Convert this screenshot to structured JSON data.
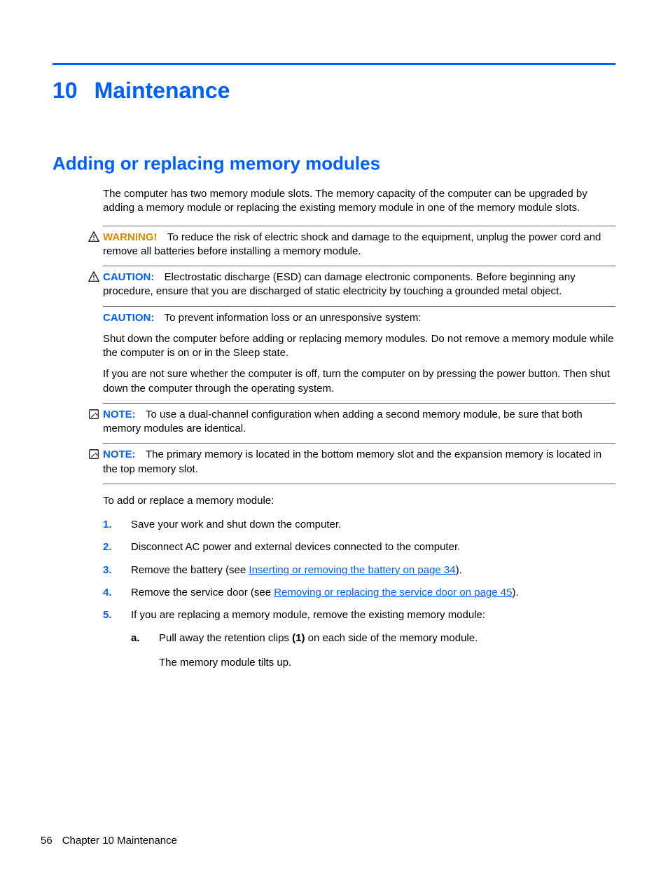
{
  "chapter": {
    "number": "10",
    "title": "Maintenance"
  },
  "section": {
    "title": "Adding or replacing memory modules"
  },
  "intro": "The computer has two memory module slots. The memory capacity of the computer can be upgraded by adding a memory module or replacing the existing memory module in one of the memory module slots.",
  "callouts": {
    "warning": {
      "label": "WARNING!",
      "text": "To reduce the risk of electric shock and damage to the equipment, unplug the power cord and remove all batteries before installing a memory module."
    },
    "caution1": {
      "label": "CAUTION:",
      "text": "Electrostatic discharge (ESD) can damage electronic components. Before beginning any procedure, ensure that you are discharged of static electricity by touching a grounded metal object."
    },
    "caution2": {
      "label": "CAUTION:",
      "text": "To prevent information loss or an unresponsive system:",
      "p2": "Shut down the computer before adding or replacing memory modules. Do not remove a memory module while the computer is on or in the Sleep state.",
      "p3": "If you are not sure whether the computer is off, turn the computer on by pressing the power button. Then shut down the computer through the operating system."
    },
    "note1": {
      "label": "NOTE:",
      "text": "To use a dual-channel configuration when adding a second memory module, be sure that both memory modules are identical."
    },
    "note2": {
      "label": "NOTE:",
      "text": "The primary memory is located in the bottom memory slot and the expansion memory is located in the top memory slot."
    }
  },
  "lead": "To add or replace a memory module:",
  "steps": [
    {
      "text": "Save your work and shut down the computer."
    },
    {
      "text": "Disconnect AC power and external devices connected to the computer."
    },
    {
      "before": "Remove the battery (see ",
      "link": "Inserting or removing the battery on page 34",
      "after": ")."
    },
    {
      "before": "Remove the service door (see ",
      "link": "Removing or replacing the service door on page 45",
      "after": ")."
    },
    {
      "text": "If you are replacing a memory module, remove the existing memory module:",
      "sub": {
        "marker": "a.",
        "before": "Pull away the retention clips ",
        "bold": "(1)",
        "after": " on each side of the memory module.",
        "p2": "The memory module tilts up."
      }
    }
  ],
  "footer": {
    "page": "56",
    "text": "Chapter 10   Maintenance"
  }
}
